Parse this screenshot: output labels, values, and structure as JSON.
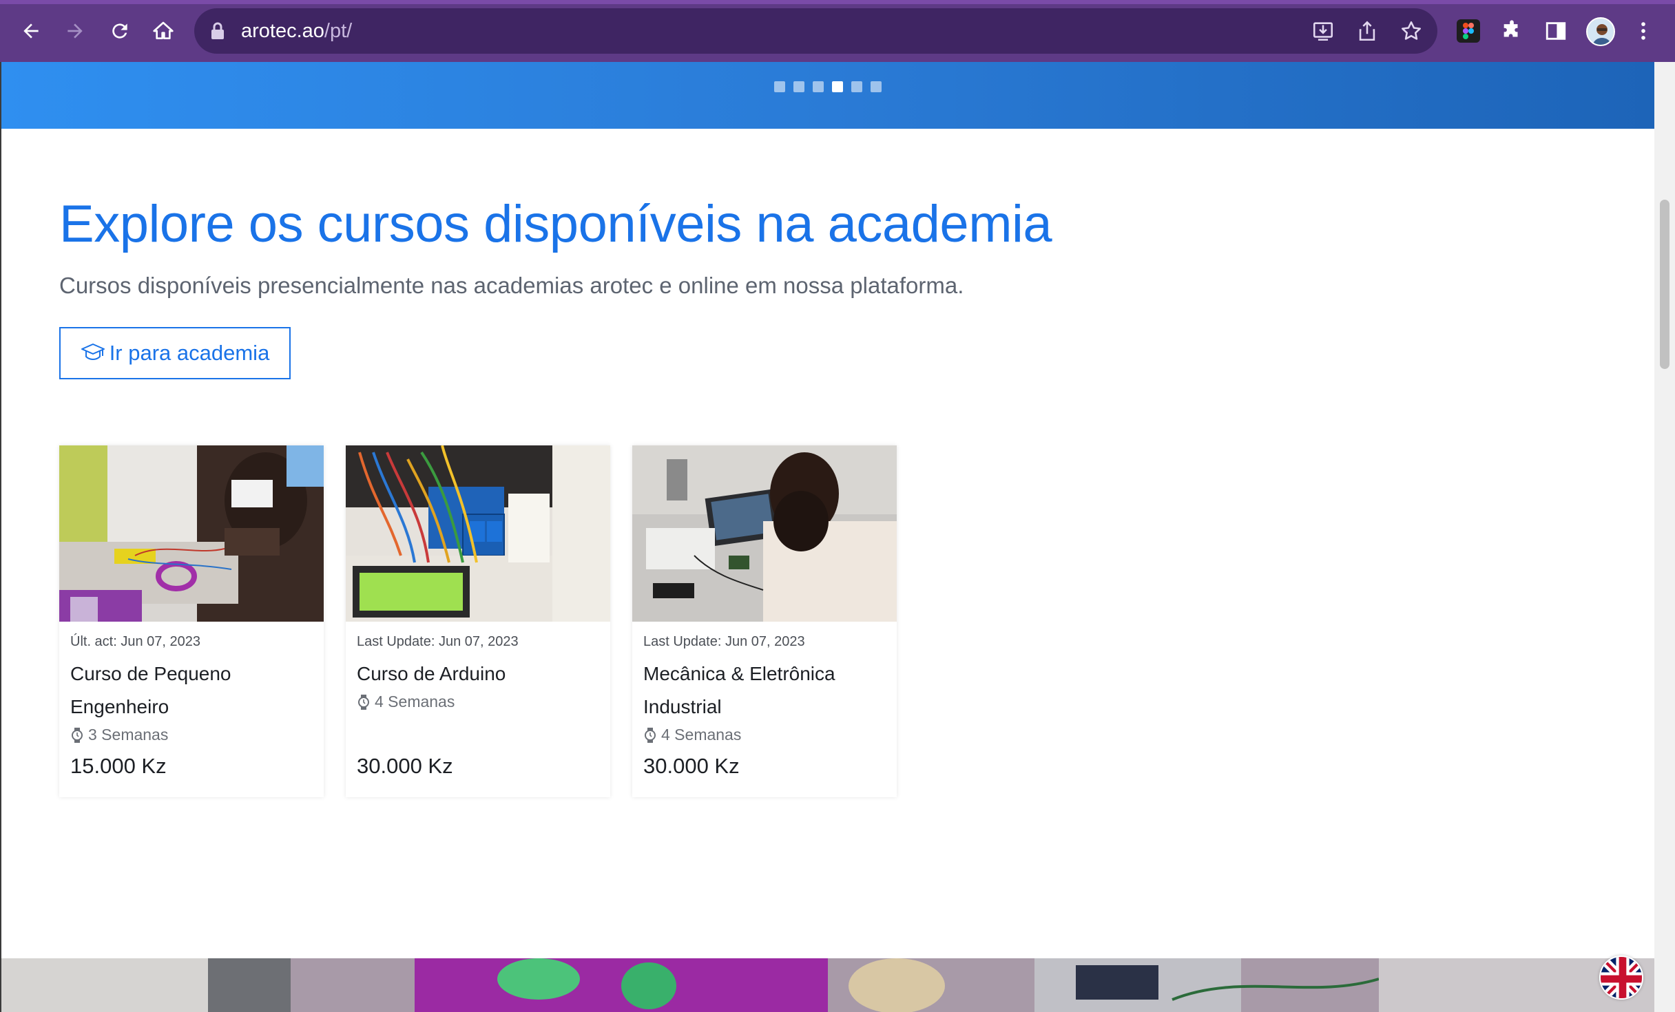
{
  "browser": {
    "url_host": "arotec.ao",
    "url_path": "/pt/",
    "icons": [
      "back-icon",
      "forward-icon",
      "reload-icon",
      "home-icon",
      "lock-icon",
      "install-icon",
      "share-icon",
      "bookmark-star-icon",
      "figma-extension-icon",
      "extensions-puzzle-icon",
      "side-panel-icon",
      "profile-avatar",
      "menu-kebab-icon"
    ],
    "theme_color": "#5e3a86"
  },
  "carousel": {
    "slide_count": 6,
    "active_index": 3
  },
  "section": {
    "heading": "Explore os cursos disponíveis na academia",
    "subtitle": "Cursos disponíveis presencialmente nas academias arotec e online em nossa plataforma.",
    "cta_label": "Ir para academia",
    "accent": "#1a73e8"
  },
  "courses": [
    {
      "meta": "Últ. act: Jun 07, 2023",
      "title": "Curso de Pequeno Engenheiro",
      "duration": "3 Semanas",
      "price": "15.000 Kz"
    },
    {
      "meta": "Last Update: Jun 07, 2023",
      "title": "Curso de Arduino",
      "duration": "4 Semanas",
      "price": "30.000 Kz"
    },
    {
      "meta": "Last Update: Jun 07, 2023",
      "title": "Mecânica & Eletrônica Industrial",
      "duration": "4 Semanas",
      "price": "30.000 Kz"
    }
  ],
  "language_switch": {
    "icon": "uk-flag-icon"
  }
}
